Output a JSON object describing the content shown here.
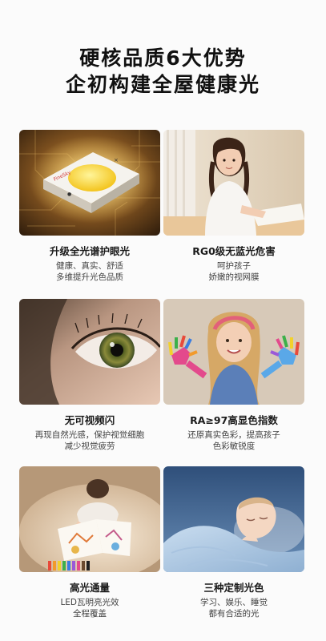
{
  "header": {
    "line1": "硬核品质6大优势",
    "line2": "企初构建全屋健康光"
  },
  "features": [
    {
      "title": "升级全光谱护眼光",
      "desc1": "健康、真实、舒适",
      "desc2": "多维提升光色品质",
      "chip_label": "FineSky"
    },
    {
      "title": "RG0级无蓝光危害",
      "desc1": "呵护孩子",
      "desc2": "娇嫩的视网膜"
    },
    {
      "title": "无可视频闪",
      "desc1": "再现自然光感，保护视觉细胞",
      "desc2": "减少视觉疲劳"
    },
    {
      "title": "RA≥97高显色指数",
      "desc1": "还原真实色彩，提高孩子",
      "desc2": "色彩敏锐度"
    },
    {
      "title": "高光通量",
      "desc1": "LED瓦明亮光效",
      "desc2": "全程覆盖"
    },
    {
      "title": "三种定制光色",
      "desc1": "学习、娱乐、睡觉",
      "desc2": "都有合适的光"
    }
  ]
}
